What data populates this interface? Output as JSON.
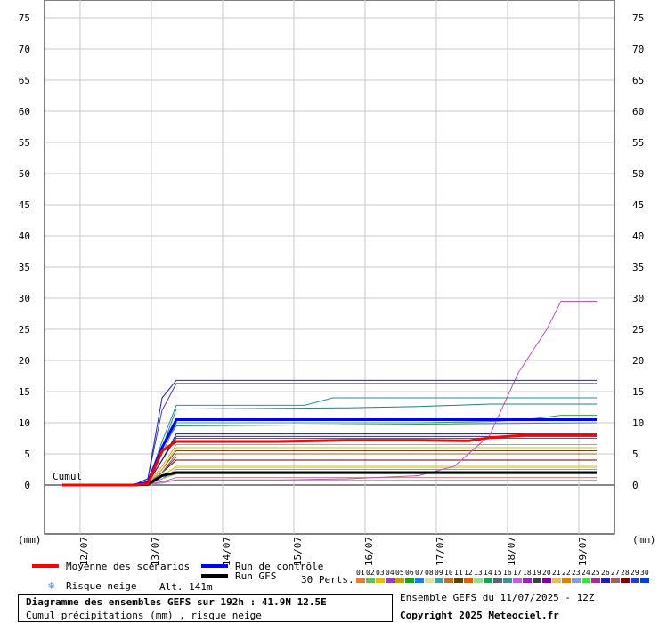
{
  "chart_data": {
    "type": "line",
    "ylim": [
      -9,
      78
    ],
    "yticks": [
      0,
      5,
      10,
      15,
      20,
      25,
      30,
      35,
      40,
      45,
      50,
      55,
      60,
      65,
      70,
      75
    ],
    "y_unit_left": "(mm)",
    "y_unit_right": "(mm)",
    "x_categories": [
      "12/07",
      "13/07",
      "14/07",
      "15/07",
      "16/07",
      "17/07",
      "18/07",
      "19/07"
    ],
    "cumul_label": "Cumul",
    "series": [
      {
        "name": "Moyenne des scénarios",
        "color": "#ff0000",
        "width": 3,
        "x": [
          0,
          1.0,
          1.2,
          1.4,
          1.6,
          2.0,
          3.0,
          4.0,
          5.0,
          5.7,
          6.0,
          6.5,
          7.0,
          7.5
        ],
        "y": [
          0,
          0,
          0.2,
          5.5,
          7,
          7,
          7,
          7.2,
          7.2,
          7.1,
          7.6,
          8.0,
          8.0,
          8.0
        ]
      },
      {
        "name": "Run de contrôle",
        "color": "#0000ff",
        "width": 3,
        "x": [
          0,
          1.0,
          1.2,
          1.4,
          1.6,
          7.5
        ],
        "y": [
          0,
          0,
          0.4,
          6,
          10.5,
          10.5
        ]
      },
      {
        "name": "Run GFS",
        "color": "#000000",
        "width": 3,
        "x": [
          0,
          1.0,
          1.2,
          1.4,
          1.6,
          7.5
        ],
        "y": [
          0,
          0,
          0.1,
          1.5,
          2,
          2
        ]
      },
      {
        "color": "#2020c0",
        "x": [
          0,
          1.0,
          1.2,
          1.4,
          1.6,
          7.5
        ],
        "y": [
          0,
          0,
          1,
          14,
          16.8,
          16.8
        ]
      },
      {
        "color": "#4040a0",
        "x": [
          0,
          1.0,
          1.2,
          1.4,
          1.6,
          7.5
        ],
        "y": [
          0,
          0,
          1,
          12,
          16.3,
          16.3
        ]
      },
      {
        "color": "#2090a0",
        "x": [
          0,
          1.0,
          1.2,
          1.4,
          1.6,
          3.4,
          3.8,
          7.5
        ],
        "y": [
          0,
          0,
          0.5,
          7,
          12.8,
          12.8,
          14,
          14
        ]
      },
      {
        "color": "#208080",
        "x": [
          0,
          1.0,
          1.2,
          1.4,
          1.6,
          4.0,
          5.0,
          6.0,
          7.5
        ],
        "y": [
          0,
          0,
          0.5,
          6,
          12.2,
          12.4,
          12.6,
          13,
          13
        ]
      },
      {
        "color": "#c050c0",
        "x": [
          0,
          1.0,
          1.2,
          1.6,
          3.0,
          4.0,
          5.0,
          5.5,
          6.0,
          6.4,
          6.8,
          7.0,
          7.5
        ],
        "y": [
          0,
          0,
          0.2,
          0.8,
          0.8,
          1,
          1.5,
          3,
          8,
          18,
          25,
          29.5,
          29.5
        ]
      },
      {
        "color": "#40a040",
        "x": [
          0,
          1.0,
          1.2,
          1.4,
          1.6,
          5.0,
          6.0,
          6.5,
          7.0,
          7.5
        ],
        "y": [
          0,
          0,
          0.5,
          5,
          10,
          10,
          10.2,
          10.5,
          11.2,
          11.2
        ]
      },
      {
        "color": "#20a060",
        "x": [
          0,
          1.0,
          1.2,
          1.4,
          1.6,
          7.5
        ],
        "y": [
          0,
          0,
          0.5,
          6,
          9.5,
          10
        ]
      },
      {
        "color": "#1010a0",
        "x": [
          0,
          1.0,
          1.2,
          1.4,
          1.6,
          7.5
        ],
        "y": [
          0,
          0,
          0.3,
          4,
          8.2,
          8.2
        ]
      },
      {
        "color": "#303080",
        "x": [
          0,
          1.0,
          1.2,
          1.4,
          1.6,
          7.5
        ],
        "y": [
          0,
          0,
          0.3,
          4,
          7.8,
          7.8
        ]
      },
      {
        "color": "#606060",
        "x": [
          0,
          1.0,
          1.2,
          1.4,
          1.6,
          7.5
        ],
        "y": [
          0,
          0,
          0.3,
          4,
          7.5,
          7.5
        ]
      },
      {
        "color": "#e0a030",
        "x": [
          0,
          1.0,
          1.2,
          1.4,
          1.6,
          7.5
        ],
        "y": [
          0,
          0,
          0.3,
          3,
          6.5,
          6.5
        ]
      },
      {
        "color": "#c0c040",
        "x": [
          0,
          1.0,
          1.2,
          1.4,
          1.6,
          7.5
        ],
        "y": [
          0,
          0,
          0.2,
          2.5,
          6,
          6
        ]
      },
      {
        "color": "#804000",
        "x": [
          0,
          1.0,
          1.2,
          1.4,
          1.6,
          7.5
        ],
        "y": [
          0,
          0,
          0.2,
          2.5,
          5.5,
          5.5
        ]
      },
      {
        "color": "#a06020",
        "x": [
          0,
          1.0,
          1.2,
          1.4,
          1.6,
          7.5
        ],
        "y": [
          0,
          0,
          0.2,
          2,
          5,
          5
        ]
      },
      {
        "color": "#703070",
        "x": [
          0,
          1.0,
          1.2,
          1.4,
          1.6,
          7.5
        ],
        "y": [
          0,
          0,
          0.2,
          2,
          4.5,
          4.5
        ]
      },
      {
        "color": "#600000",
        "x": [
          0,
          1.0,
          1.2,
          1.4,
          1.6,
          7.5
        ],
        "y": [
          0,
          0,
          0.2,
          2,
          4,
          4
        ]
      },
      {
        "color": "#d0d000",
        "x": [
          0,
          1.0,
          1.2,
          1.4,
          1.6,
          7.5
        ],
        "y": [
          0,
          0,
          0.1,
          1.5,
          3,
          3
        ]
      },
      {
        "color": "#f0c0a0",
        "x": [
          0,
          1.0,
          1.2,
          1.4,
          1.6,
          7.5
        ],
        "y": [
          0,
          0,
          0.1,
          1.5,
          2.8,
          2.8
        ]
      },
      {
        "color": "#9090c0",
        "x": [
          0,
          1.0,
          1.2,
          1.4,
          1.6,
          7.5
        ],
        "y": [
          0,
          0,
          0.1,
          1,
          2.5,
          2.5
        ]
      },
      {
        "color": "#80c080",
        "x": [
          0,
          1.0,
          1.2,
          1.4,
          1.6,
          7.5
        ],
        "y": [
          0,
          0,
          0.1,
          1,
          1.8,
          1.8
        ]
      },
      {
        "color": "#c08080",
        "x": [
          0,
          1.0,
          1.2,
          1.4,
          1.6,
          7.5
        ],
        "y": [
          0,
          0,
          0.1,
          0.5,
          1.2,
          1.2
        ]
      },
      {
        "color": "#a0a0a0",
        "x": [
          0,
          1.0,
          1.2,
          1.4,
          1.6,
          7.5
        ],
        "y": [
          0,
          0,
          0.1,
          0.3,
          0.8,
          0.8
        ]
      }
    ]
  },
  "legend": {
    "mean_label": "Moyenne des scénarios",
    "mean_color": "#ff0000",
    "control_label": "Run de contrôle",
    "control_color": "#0000ff",
    "gfs_label": "Run GFS",
    "gfs_color": "#000000",
    "snow_label": "Risque neige",
    "snow_icon": "snowflake-icon",
    "altitude": "Alt. 141m",
    "perts_label": "30 Perts.",
    "pert_numbers": [
      "01",
      "02",
      "03",
      "04",
      "05",
      "06",
      "07",
      "08",
      "09",
      "10",
      "11",
      "12",
      "13",
      "14",
      "15",
      "16",
      "17",
      "18",
      "19",
      "20",
      "21",
      "22",
      "23",
      "24",
      "25",
      "26",
      "27",
      "28",
      "29",
      "30"
    ],
    "pert_colors": [
      "#e08040",
      "#60c060",
      "#e0c000",
      "#9040c0",
      "#c0a000",
      "#20a020",
      "#2080e0",
      "#e0e0a0",
      "#40a0a0",
      "#c07030",
      "#604000",
      "#e06000",
      "#90e090",
      "#20a050",
      "#606080",
      "#4090a0",
      "#c060e0",
      "#a020c0",
      "#404040",
      "#8000a0",
      "#e0c060",
      "#e08000",
      "#80a0e0",
      "#40e040",
      "#a030a0",
      "#2020c0",
      "#a06060",
      "#800000",
      "#2040c0",
      "#0040e0"
    ]
  },
  "info": {
    "title": "Diagramme des ensembles GEFS sur 192h : 41.9N 12.5E",
    "subtitle": "Cumul précipitations (mm) , risque neige",
    "run": "Ensemble GEFS du 11/07/2025 - 12Z",
    "copyright": "Copyright 2025 Meteociel.fr"
  }
}
